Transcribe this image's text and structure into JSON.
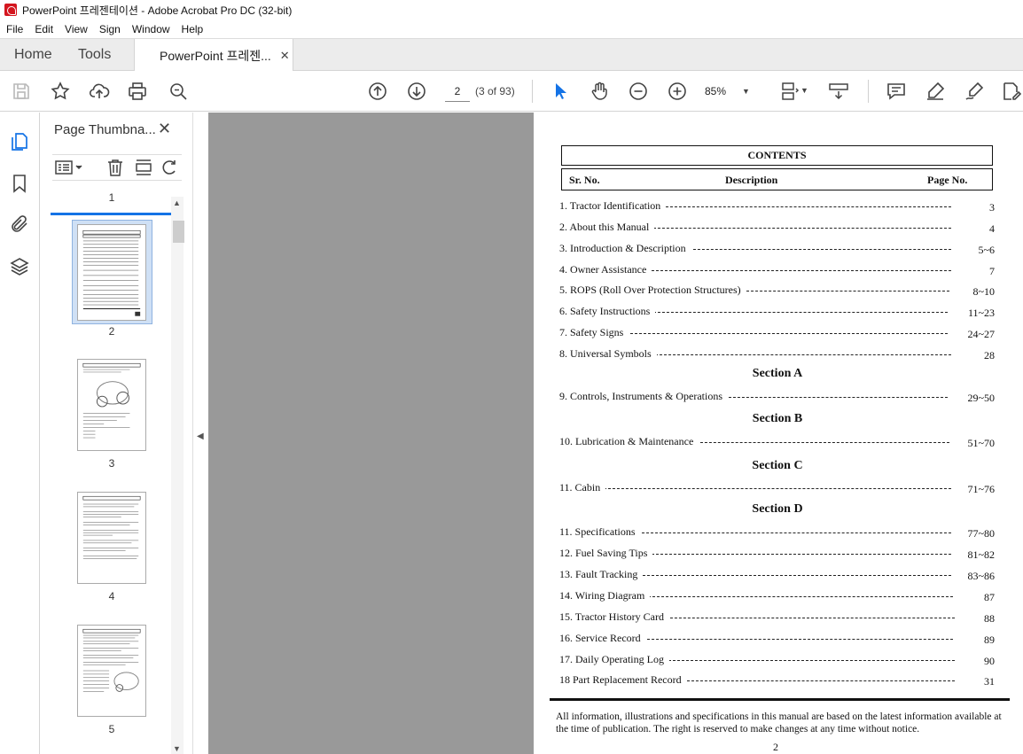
{
  "window": {
    "title": "PowerPoint 프레젠테이션 - Adobe Acrobat Pro DC (32-bit)"
  },
  "menu": [
    "File",
    "Edit",
    "View",
    "Sign",
    "Window",
    "Help"
  ],
  "tabs": {
    "home": "Home",
    "tools": "Tools",
    "document": "PowerPoint 프레젠...",
    "close": "✕"
  },
  "toolbar": {
    "page_value": "2",
    "page_count": "(3 of 93)",
    "zoom": "85%",
    "icons": [
      "save-icon",
      "star-icon",
      "upload-icon",
      "print-icon",
      "zoom-search-icon",
      "page-up-icon",
      "page-down-icon",
      "select-cursor-icon",
      "hand-icon",
      "zoom-out-icon",
      "zoom-in-icon",
      "fit-page-icon",
      "scroll-mode-icon",
      "comment-icon",
      "highlight-icon",
      "sign-icon",
      "edit-pdf-icon"
    ]
  },
  "rail": [
    "page-thumbnails-icon",
    "bookmark-icon",
    "attachment-icon",
    "layers-icon"
  ],
  "thumb_panel": {
    "title": "Page Thumbna...",
    "close": "✕",
    "top_label": "1",
    "labels": [
      "2",
      "3",
      "4",
      "5"
    ]
  },
  "document": {
    "contents": "CONTENTS",
    "header": {
      "sr": "Sr. No.",
      "description": "Description",
      "page": "Page No."
    },
    "entries": [
      {
        "label": "1.  Tractor Identification",
        "page": "3"
      },
      {
        "label": "2.  About this Manual",
        "page": "4"
      },
      {
        "label": "3.  Introduction & Description",
        "page": "5~6"
      },
      {
        "label": "4.  Owner Assistance",
        "page": "7"
      },
      {
        "label": "5.  ROPS (Roll Over Protection Structures)",
        "page": "8~10"
      },
      {
        "label": "6.  Safety Instructions",
        "page": "11~23"
      },
      {
        "label": "7.  Safety Signs",
        "page": "24~27"
      },
      {
        "label": "8.  Universal Symbols",
        "page": "28"
      },
      {
        "label": "9.  Controls, Instruments & Operations",
        "page": "29~50"
      },
      {
        "label": "10.  Lubrication & Maintenance",
        "page": "51~70"
      },
      {
        "label": "11. Cabin",
        "page": "71~76"
      },
      {
        "label": "11. Specifications",
        "page": "77~80"
      },
      {
        "label": "12. Fuel Saving Tips",
        "page": "81~82"
      },
      {
        "label": "13. Fault Tracking",
        "page": "83~86"
      },
      {
        "label": "14. Wiring Diagram",
        "page": "87"
      },
      {
        "label": "15. Tractor History Card",
        "page": "88"
      },
      {
        "label": "16. Service Record",
        "page": "89"
      },
      {
        "label": "17. Daily Operating Log",
        "page": "90"
      },
      {
        "label": "18   Part Replacement Record",
        "page": "31"
      }
    ],
    "sections": [
      "Section A",
      "Section B",
      "Section C",
      "Section D"
    ],
    "footer_note": "All information, illustrations and specifications in this manual are based on the latest information available at the time of publication. The right is reserved to make changes at any time without notice.",
    "page_number": "2"
  }
}
